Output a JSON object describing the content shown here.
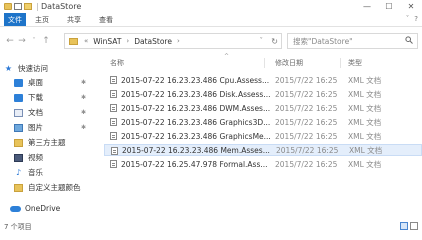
{
  "window": {
    "title": "DataStore",
    "controls": {
      "minimize": "—",
      "maximize": "☐",
      "close": "✕"
    }
  },
  "ribbon": {
    "file_tab": "文件",
    "tabs": [
      "主页",
      "共享",
      "查看"
    ],
    "right_icons": [
      "ˇ",
      "?"
    ]
  },
  "nav": {
    "back": "←",
    "forward": "→",
    "up_history": "ˇ",
    "up": "↑"
  },
  "address": {
    "prefix": "«",
    "crumbs": [
      "WinSAT",
      "DataStore"
    ],
    "separator": "›",
    "dropdown": "ˇ",
    "refresh": "↻"
  },
  "search": {
    "placeholder": "搜索\"DataStore\"",
    "icon": "search-icon"
  },
  "sidebar": {
    "items": [
      {
        "label": "快速访问",
        "icon": "star-icon",
        "pinned": false
      },
      {
        "label": "桌面",
        "icon": "desktop-icon",
        "pinned": true
      },
      {
        "label": "下载",
        "icon": "download-icon",
        "pinned": true
      },
      {
        "label": "文档",
        "icon": "document-icon",
        "pinned": true
      },
      {
        "label": "图片",
        "icon": "picture-icon",
        "pinned": true
      },
      {
        "label": "第三方主题",
        "icon": "folder-icon",
        "pinned": false
      },
      {
        "label": "视频",
        "icon": "video-icon",
        "pinned": false
      },
      {
        "label": "音乐",
        "icon": "music-icon",
        "pinned": false
      },
      {
        "label": "自定义主题颜色",
        "icon": "folder-icon",
        "pinned": false
      },
      {
        "label": "OneDrive",
        "icon": "cloud-icon",
        "pinned": false
      }
    ]
  },
  "columns": {
    "name": "名称",
    "date": "修改日期",
    "type": "类型"
  },
  "files": [
    {
      "name": "2015-07-22 16.23.23.486 Cpu.Assess...",
      "date": "2015/7/22 16:25",
      "type": "XML 文档",
      "selected": false
    },
    {
      "name": "2015-07-22 16.23.23.486 Disk.Assess...",
      "date": "2015/7/22 16:25",
      "type": "XML 文档",
      "selected": false
    },
    {
      "name": "2015-07-22 16.23.23.486 DWM.Asses...",
      "date": "2015/7/22 16:25",
      "type": "XML 文档",
      "selected": false
    },
    {
      "name": "2015-07-22 16.23.23.486 Graphics3D...",
      "date": "2015/7/22 16:25",
      "type": "XML 文档",
      "selected": false
    },
    {
      "name": "2015-07-22 16.23.23.486 GraphicsMe...",
      "date": "2015/7/22 16:25",
      "type": "XML 文档",
      "selected": false
    },
    {
      "name": "2015-07-22 16.23.23.486 Mem.Asses...",
      "date": "2015/7/22 16:25",
      "type": "XML 文档",
      "selected": true
    },
    {
      "name": "2015-07-22 16.25.47.978 Formal.Ass...",
      "date": "2015/7/22 16:25",
      "type": "XML 文档",
      "selected": false
    }
  ],
  "status": {
    "item_count": "7 个项目"
  },
  "colors": {
    "accent": "#1e74c9",
    "selection": "#e4eefb",
    "folder": "#e8c35a"
  }
}
